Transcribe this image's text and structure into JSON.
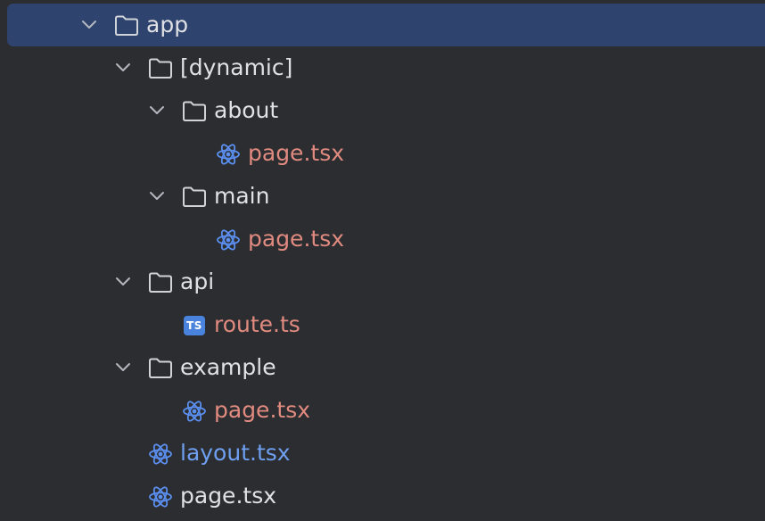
{
  "colors": {
    "background": "#2b2d30",
    "selection": "#2e436e",
    "folder_text": "#dfe1e5",
    "modified_text": "#e08a80",
    "added_text": "#6f9ff0",
    "react_icon": "#5b8ff0",
    "ts_badge": "#4a83de"
  },
  "tree": [
    {
      "label": "app",
      "type": "folder",
      "expanded": true,
      "selected": true,
      "icon": "folder-icon"
    },
    {
      "label": "[dynamic]",
      "type": "folder",
      "expanded": true,
      "icon": "folder-icon"
    },
    {
      "label": "about",
      "type": "folder",
      "expanded": true,
      "icon": "folder-icon"
    },
    {
      "label": "page.tsx",
      "type": "file",
      "status": "modified",
      "icon": "react-icon"
    },
    {
      "label": "main",
      "type": "folder",
      "expanded": true,
      "icon": "folder-icon"
    },
    {
      "label": "page.tsx",
      "type": "file",
      "status": "modified",
      "icon": "react-icon"
    },
    {
      "label": "api",
      "type": "folder",
      "expanded": true,
      "icon": "folder-icon"
    },
    {
      "label": "route.ts",
      "type": "file",
      "status": "modified",
      "icon": "typescript-icon",
      "badge_text": "TS"
    },
    {
      "label": "example",
      "type": "folder",
      "expanded": true,
      "icon": "folder-icon"
    },
    {
      "label": "page.tsx",
      "type": "file",
      "status": "modified",
      "icon": "react-icon"
    },
    {
      "label": "layout.tsx",
      "type": "file",
      "status": "added",
      "icon": "react-icon"
    },
    {
      "label": "page.tsx",
      "type": "file",
      "status": "unchanged",
      "icon": "react-icon"
    }
  ]
}
